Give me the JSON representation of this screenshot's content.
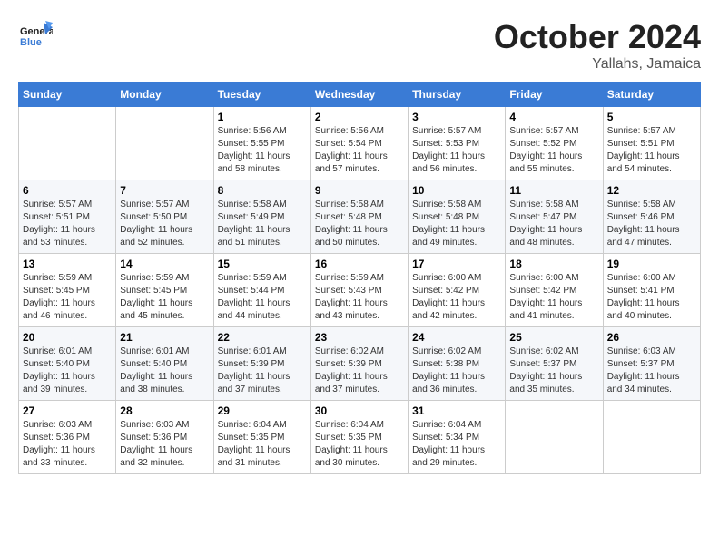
{
  "header": {
    "logo_general": "General",
    "logo_blue": "Blue",
    "month": "October 2024",
    "location": "Yallahs, Jamaica"
  },
  "weekdays": [
    "Sunday",
    "Monday",
    "Tuesday",
    "Wednesday",
    "Thursday",
    "Friday",
    "Saturday"
  ],
  "weeks": [
    [
      {
        "day": "",
        "info": ""
      },
      {
        "day": "",
        "info": ""
      },
      {
        "day": "1",
        "info": "Sunrise: 5:56 AM\nSunset: 5:55 PM\nDaylight: 11 hours and 58 minutes."
      },
      {
        "day": "2",
        "info": "Sunrise: 5:56 AM\nSunset: 5:54 PM\nDaylight: 11 hours and 57 minutes."
      },
      {
        "day": "3",
        "info": "Sunrise: 5:57 AM\nSunset: 5:53 PM\nDaylight: 11 hours and 56 minutes."
      },
      {
        "day": "4",
        "info": "Sunrise: 5:57 AM\nSunset: 5:52 PM\nDaylight: 11 hours and 55 minutes."
      },
      {
        "day": "5",
        "info": "Sunrise: 5:57 AM\nSunset: 5:51 PM\nDaylight: 11 hours and 54 minutes."
      }
    ],
    [
      {
        "day": "6",
        "info": "Sunrise: 5:57 AM\nSunset: 5:51 PM\nDaylight: 11 hours and 53 minutes."
      },
      {
        "day": "7",
        "info": "Sunrise: 5:57 AM\nSunset: 5:50 PM\nDaylight: 11 hours and 52 minutes."
      },
      {
        "day": "8",
        "info": "Sunrise: 5:58 AM\nSunset: 5:49 PM\nDaylight: 11 hours and 51 minutes."
      },
      {
        "day": "9",
        "info": "Sunrise: 5:58 AM\nSunset: 5:48 PM\nDaylight: 11 hours and 50 minutes."
      },
      {
        "day": "10",
        "info": "Sunrise: 5:58 AM\nSunset: 5:48 PM\nDaylight: 11 hours and 49 minutes."
      },
      {
        "day": "11",
        "info": "Sunrise: 5:58 AM\nSunset: 5:47 PM\nDaylight: 11 hours and 48 minutes."
      },
      {
        "day": "12",
        "info": "Sunrise: 5:58 AM\nSunset: 5:46 PM\nDaylight: 11 hours and 47 minutes."
      }
    ],
    [
      {
        "day": "13",
        "info": "Sunrise: 5:59 AM\nSunset: 5:45 PM\nDaylight: 11 hours and 46 minutes."
      },
      {
        "day": "14",
        "info": "Sunrise: 5:59 AM\nSunset: 5:45 PM\nDaylight: 11 hours and 45 minutes."
      },
      {
        "day": "15",
        "info": "Sunrise: 5:59 AM\nSunset: 5:44 PM\nDaylight: 11 hours and 44 minutes."
      },
      {
        "day": "16",
        "info": "Sunrise: 5:59 AM\nSunset: 5:43 PM\nDaylight: 11 hours and 43 minutes."
      },
      {
        "day": "17",
        "info": "Sunrise: 6:00 AM\nSunset: 5:42 PM\nDaylight: 11 hours and 42 minutes."
      },
      {
        "day": "18",
        "info": "Sunrise: 6:00 AM\nSunset: 5:42 PM\nDaylight: 11 hours and 41 minutes."
      },
      {
        "day": "19",
        "info": "Sunrise: 6:00 AM\nSunset: 5:41 PM\nDaylight: 11 hours and 40 minutes."
      }
    ],
    [
      {
        "day": "20",
        "info": "Sunrise: 6:01 AM\nSunset: 5:40 PM\nDaylight: 11 hours and 39 minutes."
      },
      {
        "day": "21",
        "info": "Sunrise: 6:01 AM\nSunset: 5:40 PM\nDaylight: 11 hours and 38 minutes."
      },
      {
        "day": "22",
        "info": "Sunrise: 6:01 AM\nSunset: 5:39 PM\nDaylight: 11 hours and 37 minutes."
      },
      {
        "day": "23",
        "info": "Sunrise: 6:02 AM\nSunset: 5:39 PM\nDaylight: 11 hours and 37 minutes."
      },
      {
        "day": "24",
        "info": "Sunrise: 6:02 AM\nSunset: 5:38 PM\nDaylight: 11 hours and 36 minutes."
      },
      {
        "day": "25",
        "info": "Sunrise: 6:02 AM\nSunset: 5:37 PM\nDaylight: 11 hours and 35 minutes."
      },
      {
        "day": "26",
        "info": "Sunrise: 6:03 AM\nSunset: 5:37 PM\nDaylight: 11 hours and 34 minutes."
      }
    ],
    [
      {
        "day": "27",
        "info": "Sunrise: 6:03 AM\nSunset: 5:36 PM\nDaylight: 11 hours and 33 minutes."
      },
      {
        "day": "28",
        "info": "Sunrise: 6:03 AM\nSunset: 5:36 PM\nDaylight: 11 hours and 32 minutes."
      },
      {
        "day": "29",
        "info": "Sunrise: 6:04 AM\nSunset: 5:35 PM\nDaylight: 11 hours and 31 minutes."
      },
      {
        "day": "30",
        "info": "Sunrise: 6:04 AM\nSunset: 5:35 PM\nDaylight: 11 hours and 30 minutes."
      },
      {
        "day": "31",
        "info": "Sunrise: 6:04 AM\nSunset: 5:34 PM\nDaylight: 11 hours and 29 minutes."
      },
      {
        "day": "",
        "info": ""
      },
      {
        "day": "",
        "info": ""
      }
    ]
  ]
}
